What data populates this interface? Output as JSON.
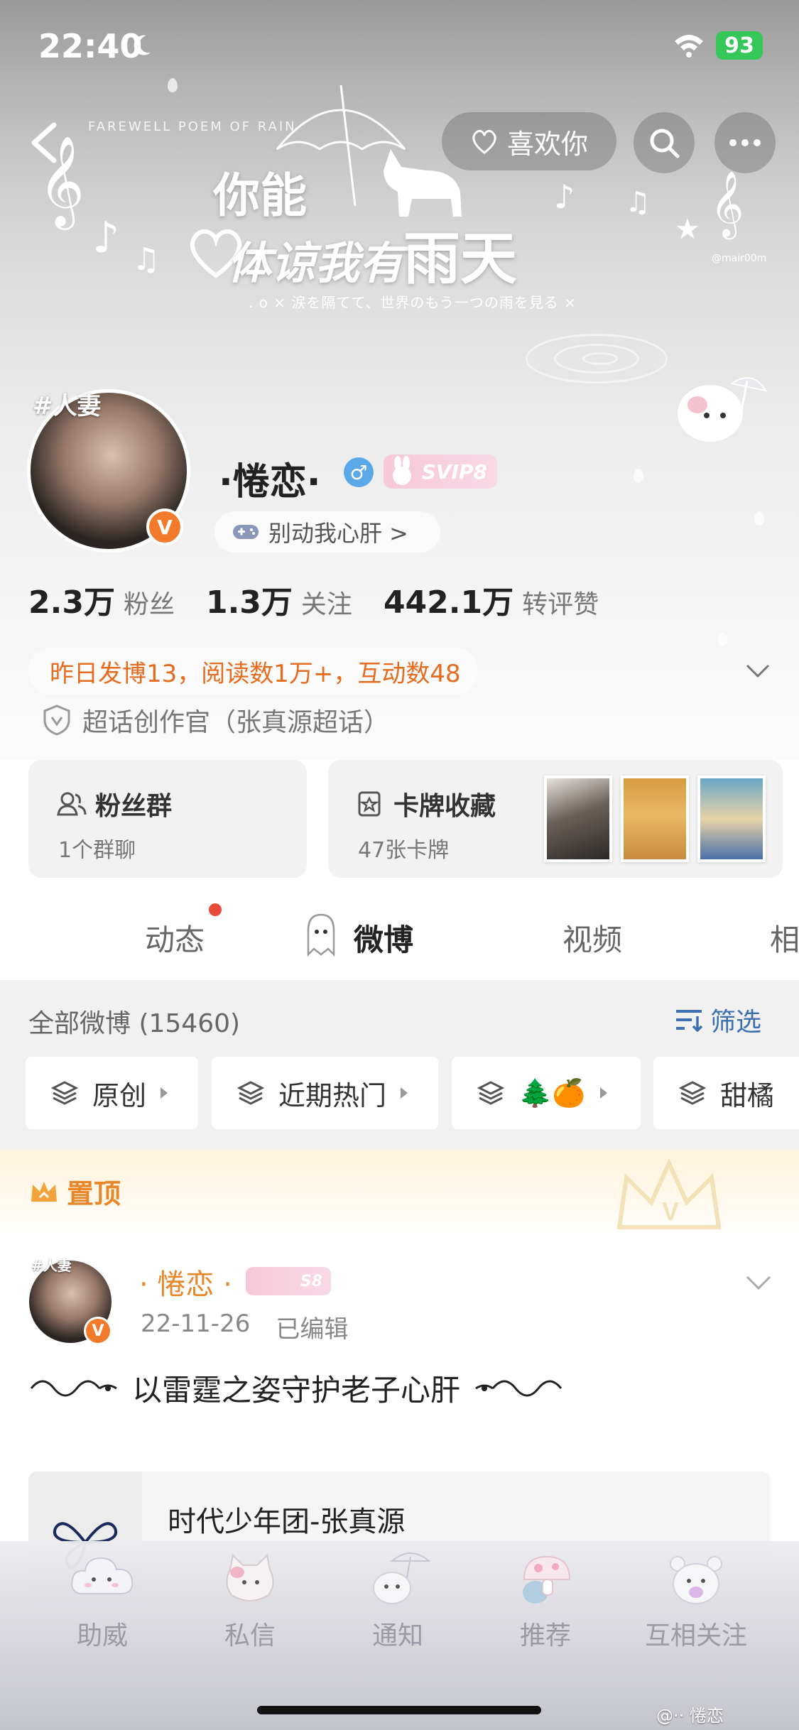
{
  "status_bar": {
    "time": "22:40",
    "battery": "93"
  },
  "header": {
    "like_label": "喜欢你",
    "banner_top_caption": "FAREWELL POEM OF RAIN",
    "banner_title": "你能",
    "banner_subtitle": "体谅我有",
    "banner_subtitle_big": "雨天",
    "banner_caption": ". o × 涙を隔てて、世界のもう一つの雨を見る ×",
    "watermark": "@mair00m"
  },
  "profile": {
    "avatar_tag": "#人妻",
    "badge_v": "V",
    "nickname": "·惓恋·",
    "gender": "♂",
    "svip": "SVIP8",
    "game_label": "别动我心肝 >",
    "stats": [
      {
        "num": "2.3万",
        "label": "粉丝"
      },
      {
        "num": "1.3万",
        "label": "关注"
      },
      {
        "num": "442.1万",
        "label": "转评赞"
      }
    ],
    "activity": "昨日发博13，阅读数1万+，互动数48",
    "creator": "超话创作官（张真源超话）"
  },
  "cards": {
    "fan_group_title": "粉丝群",
    "fan_group_sub": "1个群聊",
    "collection_title": "卡牌收藏",
    "collection_sub": "47张卡牌"
  },
  "tabs": [
    {
      "label": "动态"
    },
    {
      "label": "微博"
    },
    {
      "label": "视频"
    },
    {
      "label": "相"
    }
  ],
  "feed": {
    "header": "全部微博 (15460)",
    "filter_label": "筛选",
    "chips": [
      "原创",
      "近期热门",
      "🌲🍊",
      "甜橘"
    ],
    "pinned_label": "置顶"
  },
  "post": {
    "avatar_tag": "#人妻",
    "author": "· 惓恋 ·",
    "svip": "S8",
    "date": "22-11-26",
    "edited": "已编辑",
    "text": "以雷霆之姿守护老子心肝",
    "link_title": "时代少年团-张真源"
  },
  "bottom_nav": [
    {
      "label": "助威",
      "icon": "cloud-face-icon"
    },
    {
      "label": "私信",
      "icon": "kitty-icon"
    },
    {
      "label": "通知",
      "icon": "umbrella-bunny-icon"
    },
    {
      "label": "推荐",
      "icon": "mushroom-icon"
    },
    {
      "label": "互相关注",
      "icon": "bear-icon"
    }
  ],
  "footer_mark": "@·· 惓恋",
  "colors": {
    "accent_orange": "#e76b1e",
    "link_blue": "#3d6fb0",
    "svip_pink": "#f6c8d8",
    "verified_orange": "#f37a2b"
  }
}
